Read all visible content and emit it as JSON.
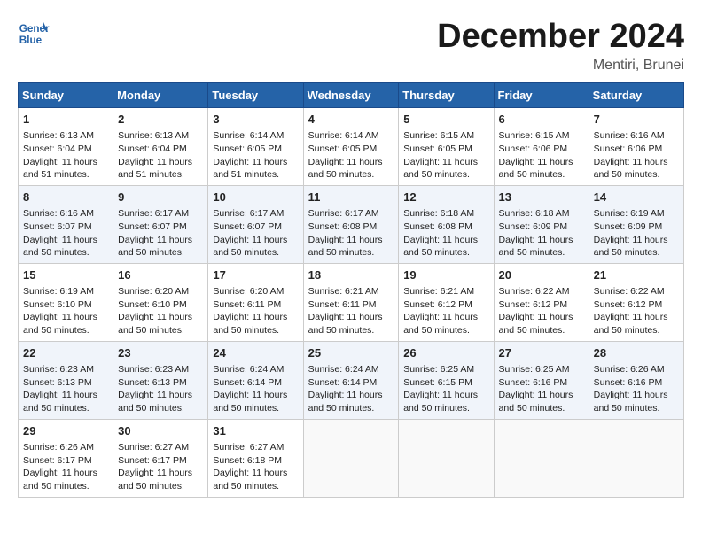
{
  "header": {
    "logo_line1": "General",
    "logo_line2": "Blue",
    "title": "December 2024",
    "subtitle": "Mentiri, Brunei"
  },
  "days_of_week": [
    "Sunday",
    "Monday",
    "Tuesday",
    "Wednesday",
    "Thursday",
    "Friday",
    "Saturday"
  ],
  "weeks": [
    [
      {
        "day": 1,
        "sunrise": "6:13 AM",
        "sunset": "6:04 PM",
        "daylight": "11 hours and 51 minutes."
      },
      {
        "day": 2,
        "sunrise": "6:13 AM",
        "sunset": "6:04 PM",
        "daylight": "11 hours and 51 minutes."
      },
      {
        "day": 3,
        "sunrise": "6:14 AM",
        "sunset": "6:05 PM",
        "daylight": "11 hours and 51 minutes."
      },
      {
        "day": 4,
        "sunrise": "6:14 AM",
        "sunset": "6:05 PM",
        "daylight": "11 hours and 50 minutes."
      },
      {
        "day": 5,
        "sunrise": "6:15 AM",
        "sunset": "6:05 PM",
        "daylight": "11 hours and 50 minutes."
      },
      {
        "day": 6,
        "sunrise": "6:15 AM",
        "sunset": "6:06 PM",
        "daylight": "11 hours and 50 minutes."
      },
      {
        "day": 7,
        "sunrise": "6:16 AM",
        "sunset": "6:06 PM",
        "daylight": "11 hours and 50 minutes."
      }
    ],
    [
      {
        "day": 8,
        "sunrise": "6:16 AM",
        "sunset": "6:07 PM",
        "daylight": "11 hours and 50 minutes."
      },
      {
        "day": 9,
        "sunrise": "6:17 AM",
        "sunset": "6:07 PM",
        "daylight": "11 hours and 50 minutes."
      },
      {
        "day": 10,
        "sunrise": "6:17 AM",
        "sunset": "6:07 PM",
        "daylight": "11 hours and 50 minutes."
      },
      {
        "day": 11,
        "sunrise": "6:17 AM",
        "sunset": "6:08 PM",
        "daylight": "11 hours and 50 minutes."
      },
      {
        "day": 12,
        "sunrise": "6:18 AM",
        "sunset": "6:08 PM",
        "daylight": "11 hours and 50 minutes."
      },
      {
        "day": 13,
        "sunrise": "6:18 AM",
        "sunset": "6:09 PM",
        "daylight": "11 hours and 50 minutes."
      },
      {
        "day": 14,
        "sunrise": "6:19 AM",
        "sunset": "6:09 PM",
        "daylight": "11 hours and 50 minutes."
      }
    ],
    [
      {
        "day": 15,
        "sunrise": "6:19 AM",
        "sunset": "6:10 PM",
        "daylight": "11 hours and 50 minutes."
      },
      {
        "day": 16,
        "sunrise": "6:20 AM",
        "sunset": "6:10 PM",
        "daylight": "11 hours and 50 minutes."
      },
      {
        "day": 17,
        "sunrise": "6:20 AM",
        "sunset": "6:11 PM",
        "daylight": "11 hours and 50 minutes."
      },
      {
        "day": 18,
        "sunrise": "6:21 AM",
        "sunset": "6:11 PM",
        "daylight": "11 hours and 50 minutes."
      },
      {
        "day": 19,
        "sunrise": "6:21 AM",
        "sunset": "6:12 PM",
        "daylight": "11 hours and 50 minutes."
      },
      {
        "day": 20,
        "sunrise": "6:22 AM",
        "sunset": "6:12 PM",
        "daylight": "11 hours and 50 minutes."
      },
      {
        "day": 21,
        "sunrise": "6:22 AM",
        "sunset": "6:12 PM",
        "daylight": "11 hours and 50 minutes."
      }
    ],
    [
      {
        "day": 22,
        "sunrise": "6:23 AM",
        "sunset": "6:13 PM",
        "daylight": "11 hours and 50 minutes."
      },
      {
        "day": 23,
        "sunrise": "6:23 AM",
        "sunset": "6:13 PM",
        "daylight": "11 hours and 50 minutes."
      },
      {
        "day": 24,
        "sunrise": "6:24 AM",
        "sunset": "6:14 PM",
        "daylight": "11 hours and 50 minutes."
      },
      {
        "day": 25,
        "sunrise": "6:24 AM",
        "sunset": "6:14 PM",
        "daylight": "11 hours and 50 minutes."
      },
      {
        "day": 26,
        "sunrise": "6:25 AM",
        "sunset": "6:15 PM",
        "daylight": "11 hours and 50 minutes."
      },
      {
        "day": 27,
        "sunrise": "6:25 AM",
        "sunset": "6:16 PM",
        "daylight": "11 hours and 50 minutes."
      },
      {
        "day": 28,
        "sunrise": "6:26 AM",
        "sunset": "6:16 PM",
        "daylight": "11 hours and 50 minutes."
      }
    ],
    [
      {
        "day": 29,
        "sunrise": "6:26 AM",
        "sunset": "6:17 PM",
        "daylight": "11 hours and 50 minutes."
      },
      {
        "day": 30,
        "sunrise": "6:27 AM",
        "sunset": "6:17 PM",
        "daylight": "11 hours and 50 minutes."
      },
      {
        "day": 31,
        "sunrise": "6:27 AM",
        "sunset": "6:18 PM",
        "daylight": "11 hours and 50 minutes."
      },
      null,
      null,
      null,
      null
    ]
  ]
}
